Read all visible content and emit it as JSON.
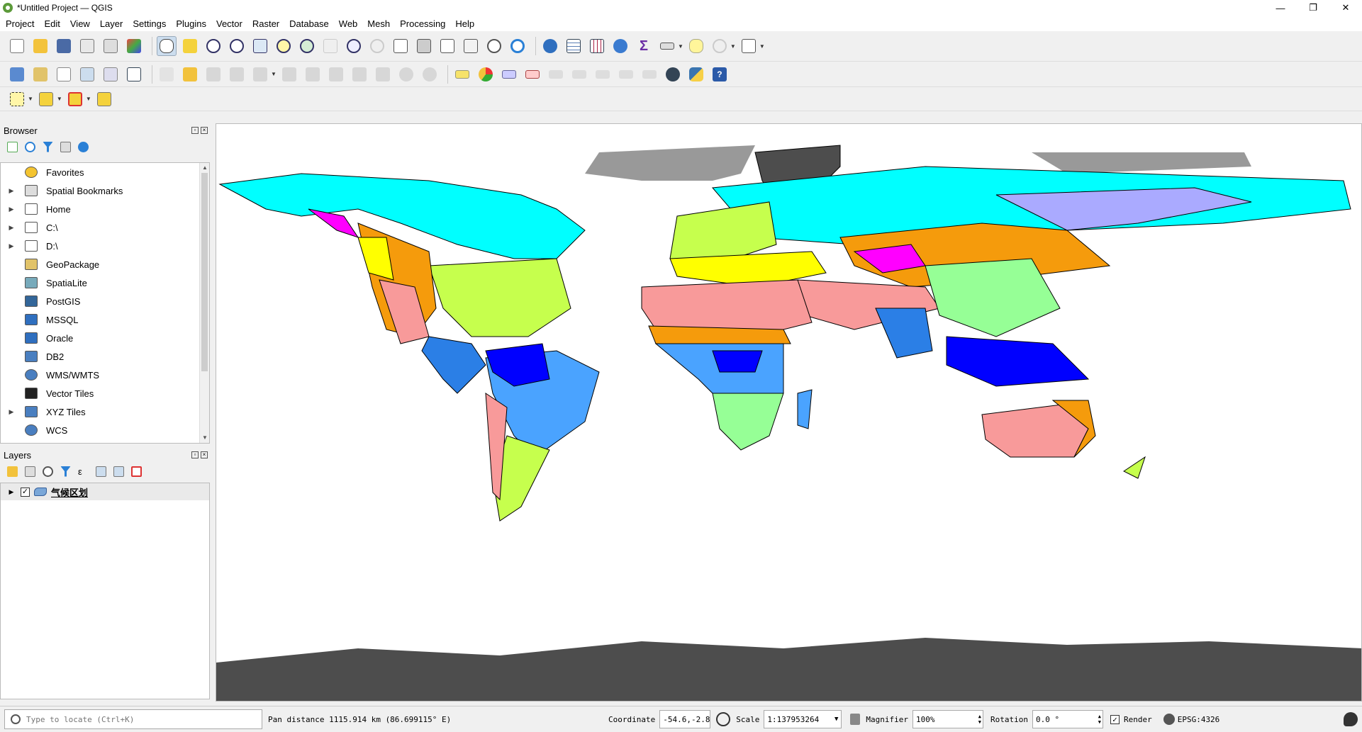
{
  "window": {
    "title": "*Untitled Project — QGIS",
    "minimize": "—",
    "maximize": "❐",
    "close": "✕"
  },
  "menu": [
    "Project",
    "Edit",
    "View",
    "Layer",
    "Settings",
    "Plugins",
    "Vector",
    "Raster",
    "Database",
    "Web",
    "Mesh",
    "Processing",
    "Help"
  ],
  "browser": {
    "title": "Browser",
    "items": [
      {
        "label": "Favorites",
        "icon": "star-icon",
        "expand": false
      },
      {
        "label": "Spatial Bookmarks",
        "icon": "bookmark-icon",
        "expand": true
      },
      {
        "label": "Home",
        "icon": "home-icon",
        "expand": true
      },
      {
        "label": "C:\\",
        "icon": "folder-icon",
        "expand": true
      },
      {
        "label": "D:\\",
        "icon": "folder-icon",
        "expand": true
      },
      {
        "label": "GeoPackage",
        "icon": "geopackage-icon",
        "expand": false
      },
      {
        "label": "SpatiaLite",
        "icon": "spatialite-icon",
        "expand": false
      },
      {
        "label": "PostGIS",
        "icon": "postgis-icon",
        "expand": false
      },
      {
        "label": "MSSQL",
        "icon": "mssql-icon",
        "expand": false
      },
      {
        "label": "Oracle",
        "icon": "oracle-icon",
        "expand": false
      },
      {
        "label": "DB2",
        "icon": "db2-icon",
        "expand": false
      },
      {
        "label": "WMS/WMTS",
        "icon": "globe-icon",
        "expand": false
      },
      {
        "label": "Vector Tiles",
        "icon": "grid-icon",
        "expand": false
      },
      {
        "label": "XYZ Tiles",
        "icon": "tiles-icon",
        "expand": true
      },
      {
        "label": "WCS",
        "icon": "globe-icon",
        "expand": false
      }
    ]
  },
  "layers": {
    "title": "Layers",
    "items": [
      {
        "label": "气候区划",
        "checked": "✓"
      }
    ]
  },
  "status": {
    "locate_placeholder": "Type to locate (Ctrl+K)",
    "message": "Pan distance 1115.914 km (86.699115° E)",
    "coordinate_label": "Coordinate",
    "coordinate_value": "-54.6,-2.8",
    "scale_label": "Scale",
    "scale_value": "1:137953264",
    "magnifier_label": "Magnifier",
    "magnifier_value": "100%",
    "rotation_label": "Rotation",
    "rotation_value": "0.0 °",
    "render_label": "Render",
    "crs": "EPSG:4326"
  },
  "colors": {
    "accent": "#2a6fb5",
    "antarctica": "#4d4d4d",
    "ice": "#999999",
    "tundra": "#00ffff",
    "desert": "#f89a9a",
    "steppe": "#f59b0c",
    "temperate": "#c6ff4d",
    "tropical_rain": "#0000ff",
    "tropical_monsoon": "#2b7fe6",
    "savanna": "#4aa3ff",
    "mediterranean": "#ffff00",
    "highland": "#ff00ff",
    "humid_subtropical": "#96ff96",
    "subarctic": "#aaaaff"
  }
}
